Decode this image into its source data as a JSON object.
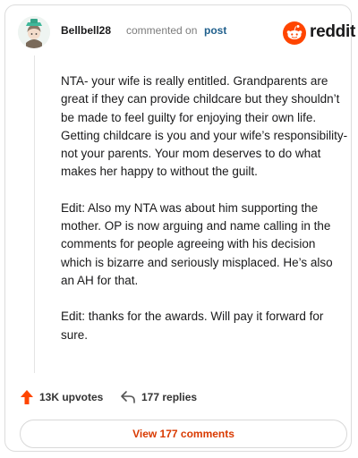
{
  "header": {
    "username": "Bellbell28",
    "action_text": "commented on",
    "post_link": "post",
    "brand_name": "reddit"
  },
  "comment": {
    "paragraphs": [
      "NTA- your wife is really entitled. Grandparents are great if they can provide childcare but they shouldn’t be made to feel guilty for enjoying their own life. Getting childcare is you and your wife’s responsibility- not your parents. Your mom deserves to do what makes her happy to without the guilt.",
      "Edit: Also my NTA was about him supporting the mother. OP is now arguing and name calling in the comments for people agreeing with his decision which is bizarre and seriously misplaced. He’s also an AH for that.",
      "Edit: thanks for the awards. Will pay it forward for sure."
    ]
  },
  "actions": {
    "upvotes": "13K upvotes",
    "replies": "177 replies"
  },
  "footer": {
    "view_label": "View 177 comments"
  },
  "icons": {
    "avatar": "avatar-icon",
    "brand": "reddit-logo-icon",
    "upvote": "upvote-arrow-icon",
    "reply": "reply-arrow-icon"
  },
  "colors": {
    "brand_orange": "#ff4500",
    "upvote": "#ff4500",
    "link": "#1f5f8c",
    "view_button_text": "#d93a00"
  }
}
